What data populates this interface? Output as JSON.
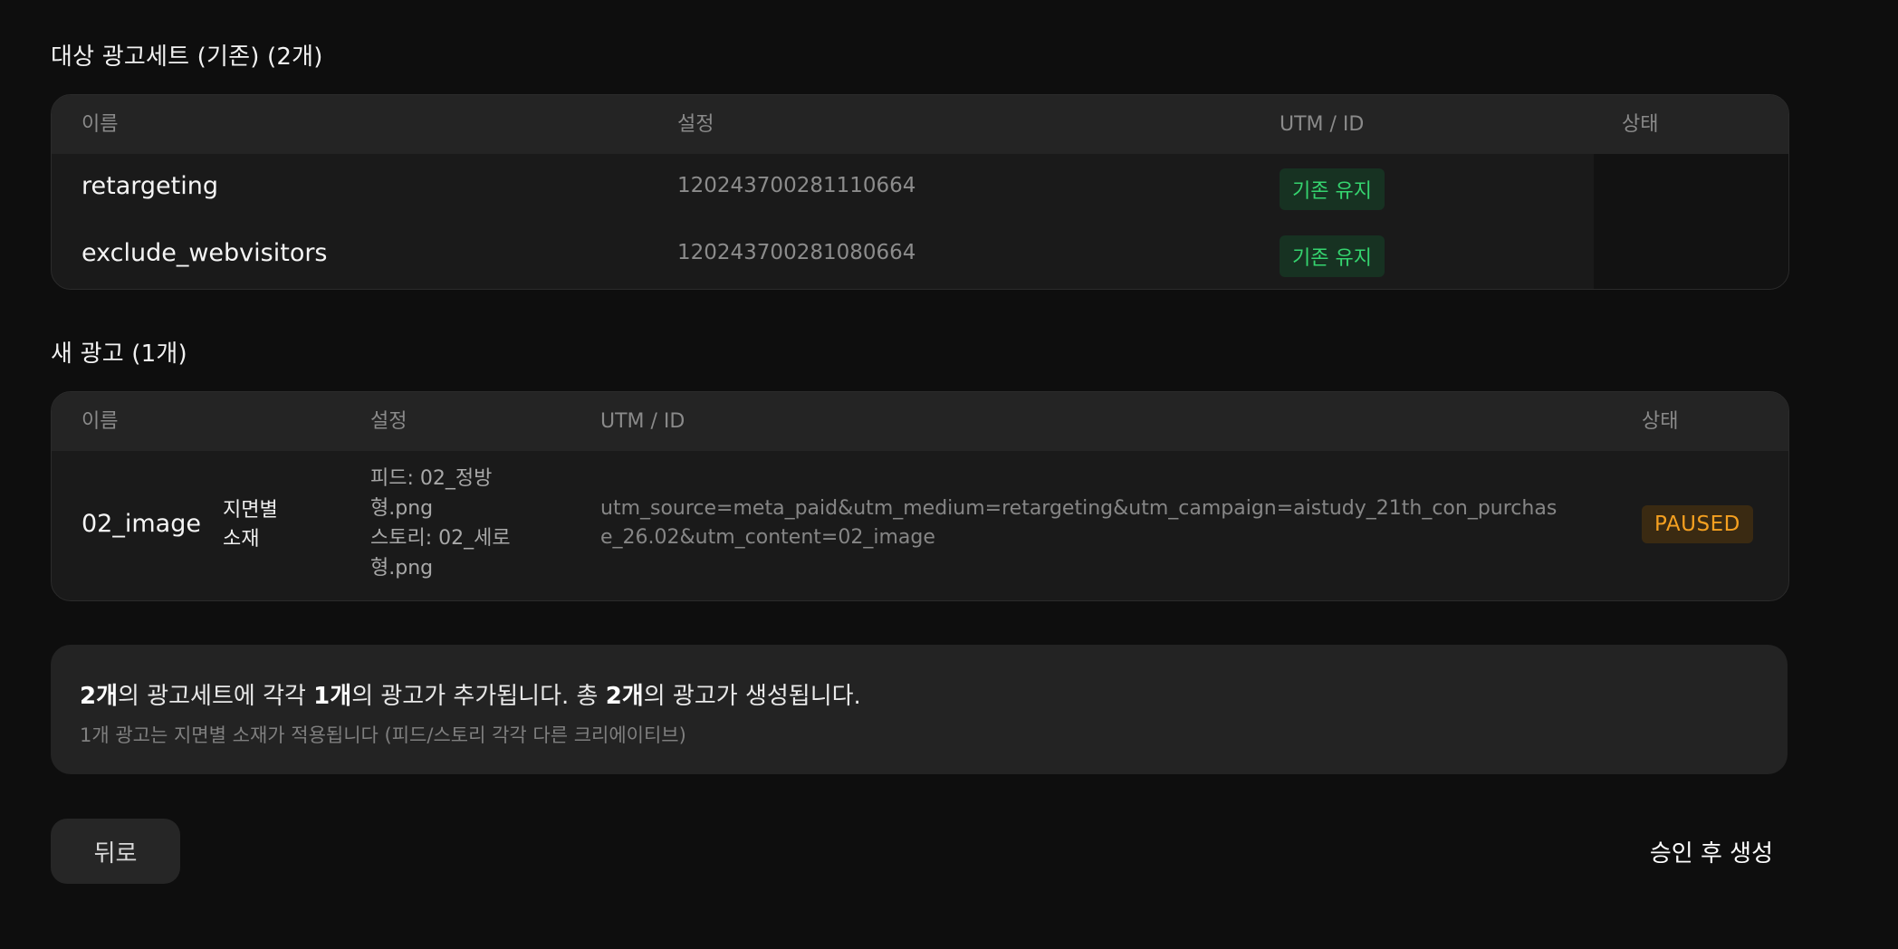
{
  "adsets_section": {
    "title": "대상 광고세트 (기존) (2개)",
    "columns": [
      "이름",
      "설정",
      "UTM / ID",
      "상태"
    ],
    "rows": [
      {
        "name": "retargeting",
        "setting": "120243700281110664",
        "utm_badge": "기존 유지"
      },
      {
        "name": "exclude_webvisitors",
        "setting": "120243700281080664",
        "utm_badge": "기존 유지"
      }
    ]
  },
  "ads_section": {
    "title": "새 광고 (1개)",
    "columns": [
      "이름",
      "설정",
      "UTM / ID",
      "상태"
    ],
    "rows": [
      {
        "name": "02_image",
        "tag_line1": "지면별",
        "tag_line2": "소재",
        "setting_line1": "피드: 02_정방",
        "setting_line2": "형.png",
        "setting_line3": "스토리: 02_세로",
        "setting_line4": "형.png",
        "utm_line1": "utm_source=meta_paid&utm_medium=retargeting&utm_campaign=aistudy_21th_con_purchas",
        "utm_line2": "e_26.02&utm_content=02_image",
        "status": "PAUSED"
      }
    ]
  },
  "summary": {
    "n_adsets": "2개",
    "text1": "의 광고세트에 각각 ",
    "n_ads_each": "1개",
    "text2": "의 광고가 추가됩니다. 총 ",
    "n_total": "2개",
    "text3": "의 광고가 생성됩니다.",
    "subtext": "1개 광고는 지면별 소재가 적용됩니다 (피드/스토리 각각 다른 크리에이티브)"
  },
  "actions": {
    "back_label": "뒤로",
    "approve_label": "승인 후 생성"
  },
  "colors": {
    "background": "#0e0e0e",
    "keep_badge_text": "#35d46f",
    "paused_badge_text": "#f5a020"
  }
}
